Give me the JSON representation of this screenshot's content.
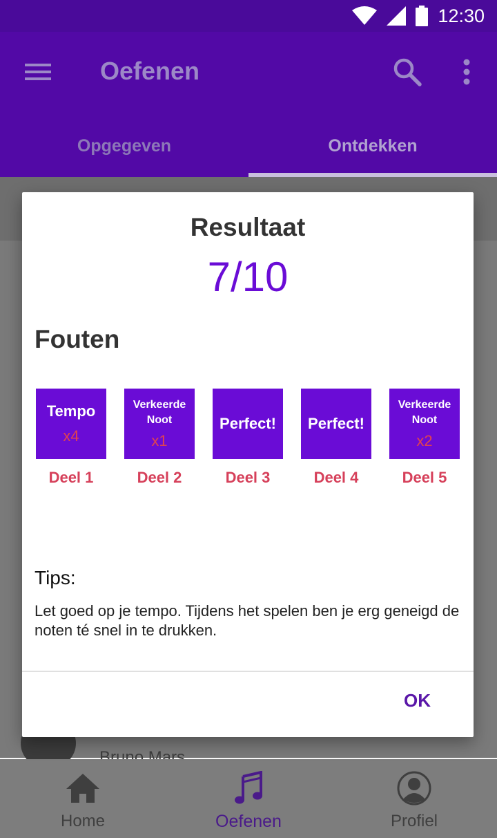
{
  "status_bar": {
    "time": "12:30",
    "icons": [
      "wifi-icon",
      "signal-icon",
      "battery-icon"
    ]
  },
  "app_bar": {
    "title": "Oefenen",
    "icons": [
      "menu-icon",
      "search-icon",
      "more-vert-icon"
    ],
    "tabs": [
      {
        "label": "Opgegeven",
        "active": false
      },
      {
        "label": "Ontdekken",
        "active": true
      }
    ]
  },
  "background": {
    "list_item_subtitle": "Bruno Mars"
  },
  "dialog": {
    "title": "Resultaat",
    "score": "7/10",
    "mistakes_heading": "Fouten",
    "parts": [
      {
        "label_lines": [
          "Tempo"
        ],
        "count": "x4",
        "part_label": "Deel 1"
      },
      {
        "label_lines": [
          "Verkeerde",
          "Noot"
        ],
        "count": "x1",
        "part_label": "Deel 2"
      },
      {
        "label_lines": [
          "Perfect!"
        ],
        "count": "",
        "part_label": "Deel 3"
      },
      {
        "label_lines": [
          "Perfect!"
        ],
        "count": "",
        "part_label": "Deel 4"
      },
      {
        "label_lines": [
          "Verkeerde",
          "Noot"
        ],
        "count": "x2",
        "part_label": "Deel 5"
      }
    ],
    "tips_heading": "Tips:",
    "tips_text": "Let goed op je tempo. Tijdens het spelen ben je erg geneigd de noten té snel in te drukken.",
    "ok_label": "OK"
  },
  "bottom_nav": [
    {
      "label": "Home",
      "icon": "home-icon",
      "active": false
    },
    {
      "label": "Oefenen",
      "icon": "music-note-icon",
      "active": true
    },
    {
      "label": "Profiel",
      "icon": "profile-icon",
      "active": false
    }
  ],
  "colors": {
    "primary": "#5209a6",
    "accent": "#6a0cd6",
    "error": "#d6405a"
  }
}
